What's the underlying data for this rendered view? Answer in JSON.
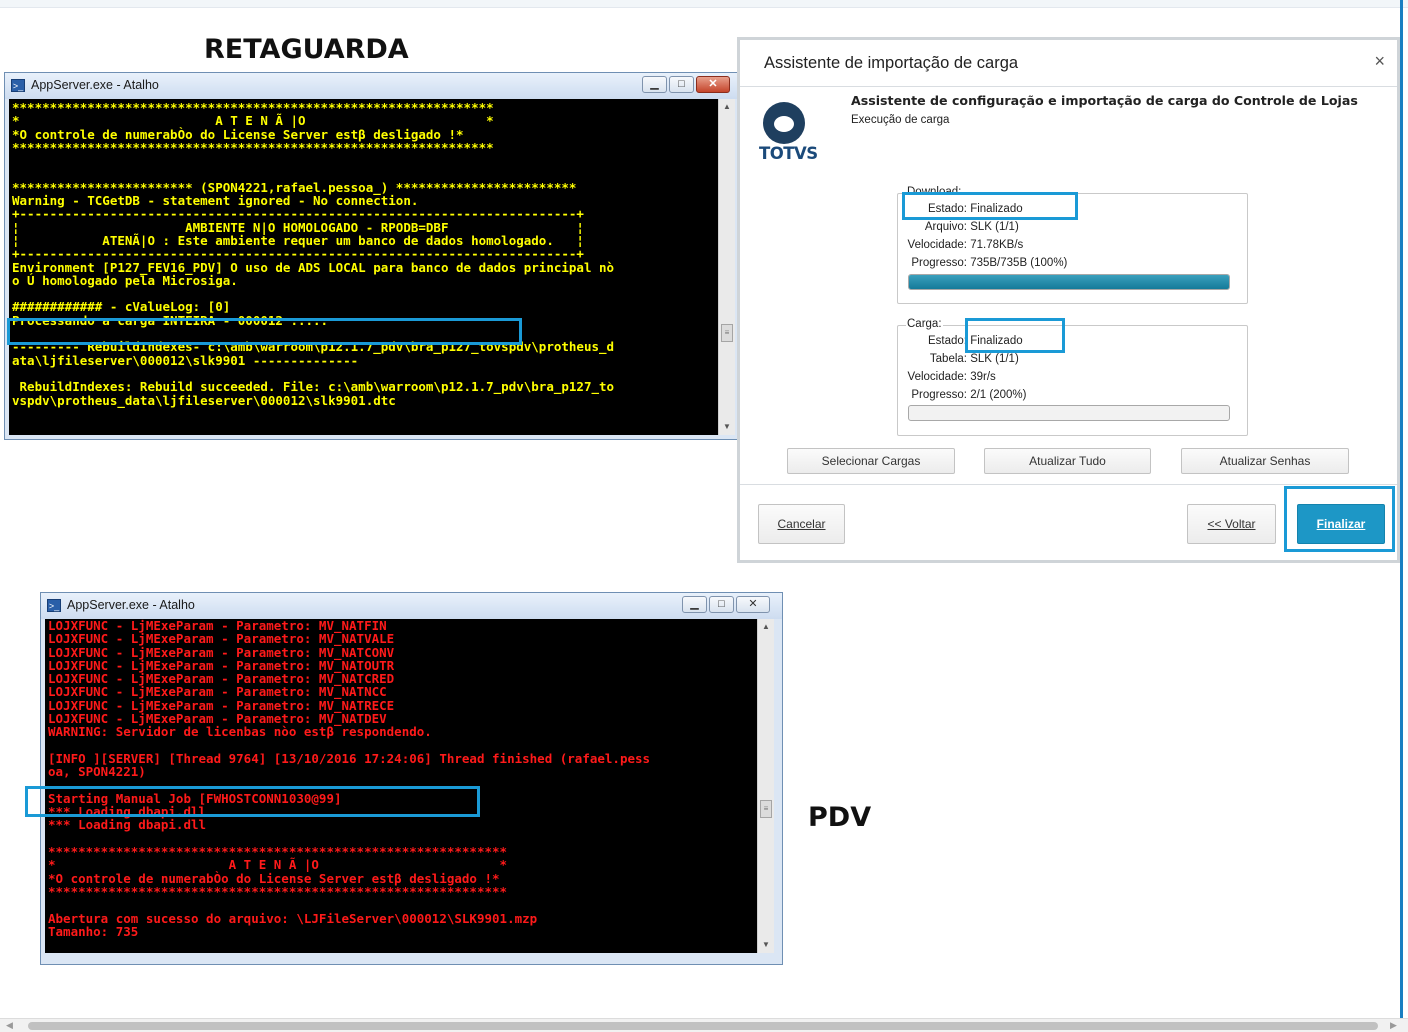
{
  "headings": {
    "retaguarda": "RETAGUARDA",
    "pdv": "PDV"
  },
  "retaguarda_window": {
    "title": "AppServer.exe - Atalho",
    "lines": [
      "****************************************************************",
      "*                          A T E N Ã |O                        *",
      "*O controle de numerabÒo do License Server estβ desligado !*",
      "****************************************************************",
      "",
      "",
      "************************ (SPON4221,rafael.pessoa_) ************************",
      "Warning - TCGetDB - statement ignored - No connection.",
      "+--------------------------------------------------------------------------+",
      "¦                      AMBIENTE N|O HOMOLOGADO - RPODB=DBF                 ¦",
      "¦           ATENÃ|O : Este ambiente requer um banco de dados homologado.   ¦",
      "+--------------------------------------------------------------------------+",
      "Environment [P127_FEV16_PDV] O uso de ADS LOCAL para banco de dados principal nò",
      "o Ú homologado pela Microsiga.",
      "",
      "############ - cValueLog: [0]",
      "Processando a carga INTEIRA - 000012 .....",
      "",
      "--------- RebuildIndexes- c:\\amb\\warroom\\p12.1.7_pdv\\bra_p127_tovspdv\\protheus_d",
      "ata\\ljfileserver\\000012\\slk9901 --------------",
      "",
      " RebuildIndexes: Rebuild succeeded. File: c:\\amb\\warroom\\p12.1.7_pdv\\bra_p127_to",
      "vspdv\\protheus_data\\ljfileserver\\000012\\slk9901.dtc"
    ]
  },
  "pdv_window": {
    "title": "AppServer.exe - Atalho",
    "lines": [
      "LOJXFUNC - LjMExeParam - Parametro: MV_NATFIN",
      "LOJXFUNC - LjMExeParam - Parametro: MV_NATVALE",
      "LOJXFUNC - LjMExeParam - Parametro: MV_NATCONV",
      "LOJXFUNC - LjMExeParam - Parametro: MV_NATOUTR",
      "LOJXFUNC - LjMExeParam - Parametro: MV_NATCRED",
      "LOJXFUNC - LjMExeParam - Parametro: MV_NATNCC",
      "LOJXFUNC - LjMExeParam - Parametro: MV_NATRECE",
      "LOJXFUNC - LjMExeParam - Parametro: MV_NATDEV",
      "WARNING: Servidor de licenbas nòo estβ respondendo.",
      "",
      "[INFO ][SERVER] [Thread 9764] [13/10/2016 17:24:06] Thread finished (rafael.pess",
      "oa, SPON4221)",
      "",
      "Starting Manual Job [FWHOSTCONN1030@99]",
      "*** Loading dbapi.dll",
      "*** Loading dbapi.dll",
      "",
      "*************************************************************",
      "*                       A T E N Ã |O                        *",
      "*O controle de numerabÒo do License Server estβ desligado !*",
      "*************************************************************",
      "",
      "Abertura com sucesso do arquivo: \\LJFileServer\\000012\\SLK9901.mzp",
      "Tamanho: 735"
    ]
  },
  "dialog": {
    "title": "Assistente de importação de carga",
    "close_glyph": "×",
    "logo_text": "TOTVS",
    "heading": "Assistente de configuração e importação de carga do Controle de Lojas",
    "subheading": "Execução de carga",
    "download": {
      "legend": "Download:",
      "estado_label": "Estado:",
      "estado": "Finalizado",
      "arquivo_label": "Arquivo:",
      "arquivo": "SLK (1/1)",
      "velocidade_label": "Velocidade:",
      "velocidade": "71.78KB/s",
      "progresso_label": "Progresso:",
      "progresso": "735B/735B (100%)",
      "progress_fraction": 1.0
    },
    "carga": {
      "legend": "Carga:",
      "estado_label": "Estado:",
      "estado": "Finalizado",
      "tabela_label": "Tabela:",
      "tabela": "SLK (1/1)",
      "velocidade_label": "Velocidade:",
      "velocidade": "39r/s",
      "progresso_label": "Progresso:",
      "progresso": "2/1 (200%)",
      "progress_fraction": 0.0
    },
    "buttons": {
      "selecionar": "Selecionar Cargas",
      "atualizar_tudo": "Atualizar Tudo",
      "atualizar_senhas": "Atualizar Senhas",
      "cancelar": "Cancelar",
      "voltar": "<< Voltar",
      "finalizar": "Finalizar"
    }
  },
  "colors": {
    "retaguarda_text": "#ffff00",
    "pdv_text": "#ff1a1a",
    "highlight": "#1a9ad6",
    "primary_button": "#1d97c6",
    "progress_fill": "#157a99"
  }
}
